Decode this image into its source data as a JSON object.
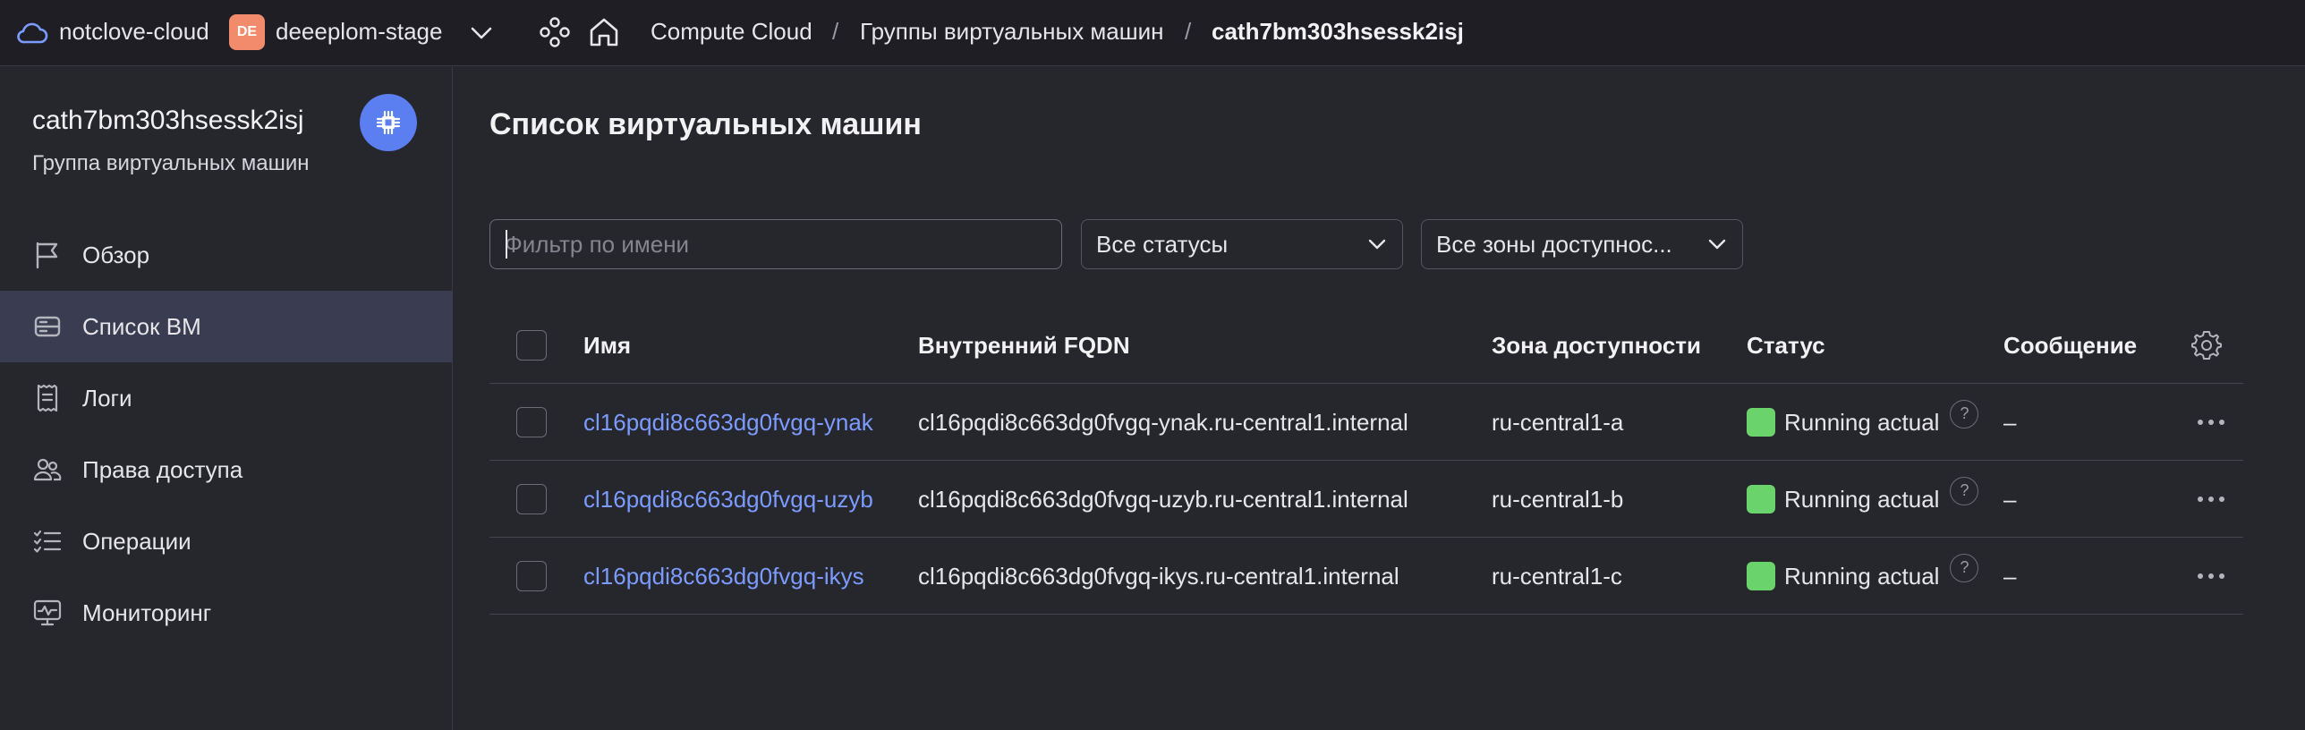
{
  "topbar": {
    "cloud_name": "notclove-cloud",
    "folder_badge": "DE",
    "folder_name": "deeeplom-stage",
    "breadcrumbs": [
      "Compute Cloud",
      "Группы виртуальных машин",
      "cath7bm303hsessk2isj"
    ],
    "separator": "/"
  },
  "sidebar": {
    "title": "cath7bm303hsessk2isj",
    "subtitle": "Группа виртуальных машин",
    "items": [
      {
        "label": "Обзор",
        "icon": "flag-icon",
        "active": false
      },
      {
        "label": "Список ВМ",
        "icon": "server-list-icon",
        "active": true
      },
      {
        "label": "Логи",
        "icon": "receipt-icon",
        "active": false
      },
      {
        "label": "Права доступа",
        "icon": "users-icon",
        "active": false
      },
      {
        "label": "Операции",
        "icon": "checklist-icon",
        "active": false
      },
      {
        "label": "Мониторинг",
        "icon": "monitor-icon",
        "active": false
      }
    ]
  },
  "main": {
    "title": "Список виртуальных машин",
    "filter_placeholder": "Фильтр по имени",
    "status_select": "Все статусы",
    "zone_select": "Все зоны доступнос...",
    "columns": [
      "Имя",
      "Внутренний FQDN",
      "Зона доступности",
      "Статус",
      "Сообщение"
    ],
    "rows": [
      {
        "name": "cl16pqdi8c663dg0fvgq-ynak",
        "fqdn": "cl16pqdi8c663dg0fvgq-ynak.ru-central1.internal",
        "zone": "ru-central1-a",
        "status": "Running actual",
        "message": "–"
      },
      {
        "name": "cl16pqdi8c663dg0fvgq-uzyb",
        "fqdn": "cl16pqdi8c663dg0fvgq-uzyb.ru-central1.internal",
        "zone": "ru-central1-b",
        "status": "Running actual",
        "message": "–"
      },
      {
        "name": "cl16pqdi8c663dg0fvgq-ikys",
        "fqdn": "cl16pqdi8c663dg0fvgq-ikys.ru-central1.internal",
        "zone": "ru-central1-c",
        "status": "Running actual",
        "message": "–"
      }
    ],
    "help_glyph": "?"
  },
  "colors": {
    "background": "#26262d",
    "topbar": "#1e1e24",
    "accent": "#5b7ff0",
    "link": "#7c9bff",
    "status_running": "#6bd36b",
    "folder_badge": "#f28b6b",
    "active_nav": "#3a3d52"
  }
}
